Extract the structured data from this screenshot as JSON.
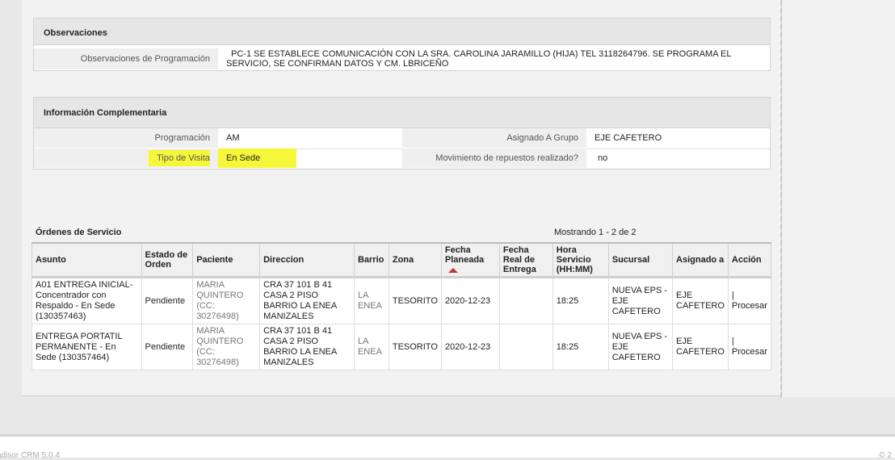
{
  "observaciones": {
    "title": "Observaciones",
    "label": "Observaciones de Programación",
    "value": "PC-1 SE ESTABLECE COMUNICACIÓN CON LA SRA. CAROLINA JARAMILLO (HIJA) TEL 3118264796. SE PROGRAMA EL SERVICIO, SE CONFIRMAN DATOS Y CM. LBRICEÑO"
  },
  "info": {
    "title": "Información Complementaria",
    "programacion_label": "Programación",
    "programacion_value": "AM",
    "grupo_label": "Asignado A Grupo",
    "grupo_value": "EJE CAFETERO",
    "visita_label": "Tipo de Visita",
    "visita_value": "En Sede",
    "repuestos_label": "Movimiento de repuestos realizado?",
    "repuestos_value": "no",
    "highlight_color": "#f7f73a"
  },
  "orders": {
    "title": "Órdenes de Servicio",
    "showing": "Mostrando 1 - 2 de 2",
    "headers": [
      "Asunto",
      "Estado de Orden",
      "Paciente",
      "Direccion",
      "Barrio",
      "Zona",
      "Fecha Planeada",
      "Fecha Real de Entrega",
      "Hora Servicio (HH:MM)",
      "Sucursal",
      "Asignado a",
      "Acción"
    ],
    "rows": [
      {
        "asunto": "A01 ENTREGA INICIAL- Concentrador con Respaldo - En Sede (130357463)",
        "estado": "Pendiente",
        "paciente": "MARIA QUINTERO (CC: 30276498)",
        "direccion": "CRA 37 101 B 41 CASA 2 PISO BARRIO LA ENEA MANIZALES",
        "barrio": "LA ENEA",
        "zona": "TESORITO",
        "fecha_planeada": "2020-12-23",
        "fecha_real": "",
        "hora": "18:25",
        "sucursal": "NUEVA EPS - EJE CAFETERO",
        "asignado": "EJE CAFETERO",
        "accion_sep": "|",
        "accion": "Procesar"
      },
      {
        "asunto": "ENTREGA PORTATIL PERMANENTE - En Sede (130357464)",
        "estado": "Pendiente",
        "paciente": "MARIA QUINTERO (CC: 30276498)",
        "direccion": "CRA 37 101 B 41 CASA 2 PISO BARRIO LA ENEA MANIZALES",
        "barrio": "LA ENEA",
        "zona": "TESORITO",
        "fecha_planeada": "2020-12-23",
        "fecha_real": "",
        "hora": "18:25",
        "sucursal": "NUEVA EPS - EJE CAFETERO",
        "asignado": "EJE CAFETERO",
        "accion_sep": "|",
        "accion": "Procesar"
      }
    ]
  },
  "footer": {
    "left": "adisor CRM 5.0.4",
    "right": "© 2"
  }
}
